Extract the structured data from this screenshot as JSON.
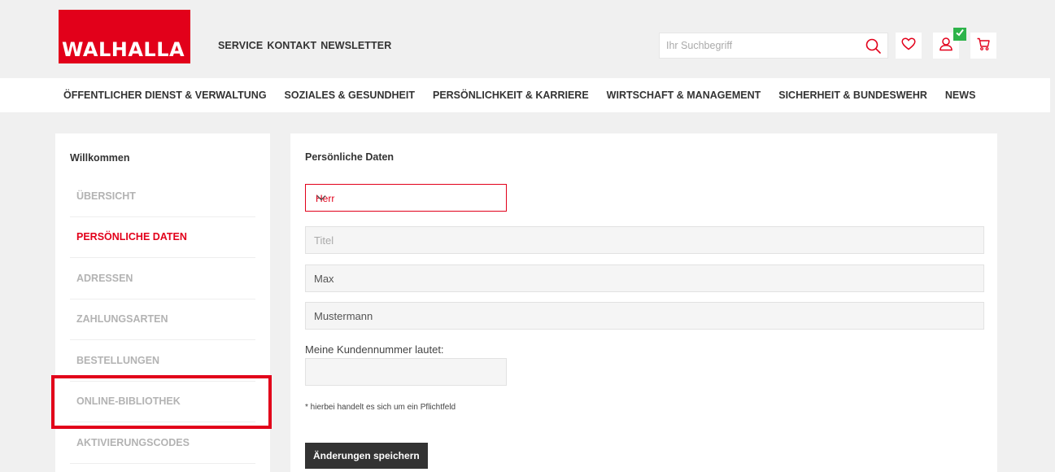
{
  "brand": {
    "logo_text": "WALHALLA",
    "color": "#e2001a"
  },
  "topnav": [
    "SERVICE",
    "KONTAKT",
    "NEWSLETTER"
  ],
  "search": {
    "placeholder": "Ihr Suchbegriff",
    "value": ""
  },
  "header_icons": [
    "search-icon",
    "heart-icon",
    "user-icon",
    "cart-icon"
  ],
  "categories": [
    "ÖFFENTLICHER DIENST & VERWALTUNG",
    "SOZIALES & GESUNDHEIT",
    "PERSÖNLICHKEIT & KARRIERE",
    "WIRTSCHAFT & MANAGEMENT",
    "SICHERHEIT & BUNDESWEHR",
    "NEWS"
  ],
  "sidebar": {
    "welcome": "Willkommen",
    "items": [
      {
        "label": "ÜBERSICHT",
        "active": false
      },
      {
        "label": "PERSÖNLICHE DATEN",
        "active": true
      },
      {
        "label": "ADRESSEN",
        "active": false
      },
      {
        "label": "ZAHLUNGSARTEN",
        "active": false
      },
      {
        "label": "BESTELLUNGEN",
        "active": false
      },
      {
        "label": "ONLINE-BIBLIOTHEK",
        "active": false
      },
      {
        "label": "AKTIVIERUNGSCODES",
        "active": false
      }
    ]
  },
  "form": {
    "heading": "Persönliche Daten",
    "salutation": "Herr",
    "title_placeholder": "Titel",
    "title_value": "",
    "firstname": "Max",
    "lastname": "Mustermann",
    "customer_label": "Meine Kundennummer lautet:",
    "customer_value": "",
    "note": "* hierbei handelt es sich um ein Pflichtfeld",
    "save": "Änderungen speichern"
  }
}
